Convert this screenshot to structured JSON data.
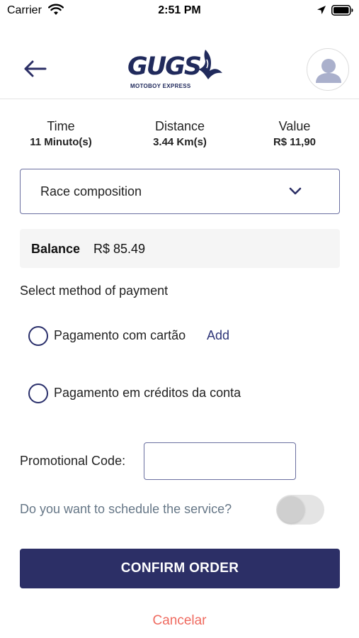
{
  "status_bar": {
    "carrier": "Carrier",
    "time": "2:51 PM",
    "icons": [
      "wifi-icon",
      "location-arrow-icon",
      "battery-icon"
    ]
  },
  "header": {
    "logo_text": "GUGS",
    "logo_subtitle": "MOTOBOY EXPRESS",
    "icons": [
      "back-arrow-icon",
      "user-avatar-icon"
    ]
  },
  "stats": {
    "time": {
      "label": "Time",
      "value": "11 Minuto(s)"
    },
    "distance": {
      "label": "Distance",
      "value": "3.44 Km(s)"
    },
    "value": {
      "label": "Value",
      "value": "R$ 11,90"
    }
  },
  "race_composition": {
    "label": "Race composition",
    "icon": "chevron-down-icon"
  },
  "balance": {
    "label": "Balance",
    "value": "R$ 85.49"
  },
  "payment": {
    "heading": "Select method of payment",
    "options": [
      {
        "label": "Pagamento com cartão",
        "action": "Add",
        "selected": false
      },
      {
        "label": "Pagamento em créditos da conta",
        "selected": false
      }
    ]
  },
  "promo": {
    "label": "Promotional Code:",
    "value": "",
    "placeholder": ""
  },
  "schedule": {
    "label": "Do you want to schedule the service?",
    "enabled": false
  },
  "actions": {
    "confirm": "CONFIRM ORDER",
    "cancel": "Cancelar"
  },
  "colors": {
    "primary": "#2c2f66",
    "cancel": "#ef6a5f",
    "link": "#2e3578",
    "muted_text": "#667787",
    "balance_bg": "#f5f5f5"
  }
}
